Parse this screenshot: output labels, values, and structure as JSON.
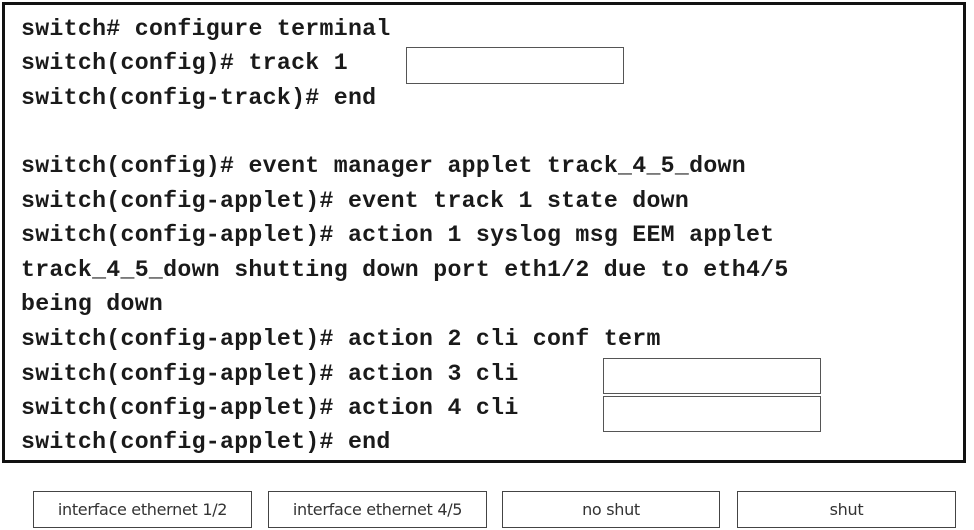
{
  "config": {
    "lines": [
      {
        "prompt": "switch#",
        "command": "configure terminal"
      },
      {
        "prompt": "switch(config)#",
        "command": "track 1"
      },
      {
        "prompt": "switch(config-track)#",
        "command": "end"
      },
      {
        "prompt": "switch(config)#",
        "command": "event manager applet track_4_5_down"
      },
      {
        "prompt": "switch(config-applet)#",
        "command": "event track 1 state down"
      },
      {
        "prompt": "switch(config-applet)#",
        "command": "action 1 syslog msg EEM applet"
      },
      {
        "prompt": "",
        "command": "track_4_5_down shutting down port eth1/2 due to eth4/5"
      },
      {
        "prompt": "",
        "command": "being down"
      },
      {
        "prompt": "switch(config-applet)#",
        "command": "action 2 cli conf term"
      },
      {
        "prompt": "switch(config-applet)#",
        "command": "action 3 cli"
      },
      {
        "prompt": "switch(config-applet)#",
        "command": "action 4 cli"
      },
      {
        "prompt": "switch(config-applet)#",
        "command": "end"
      }
    ],
    "drop_targets": {
      "track_1": "",
      "action_3": "",
      "action_4": ""
    }
  },
  "choices": [
    {
      "label": "interface ethernet 1/2"
    },
    {
      "label": "interface ethernet 4/5"
    },
    {
      "label": "no shut"
    },
    {
      "label": "shut"
    }
  ]
}
